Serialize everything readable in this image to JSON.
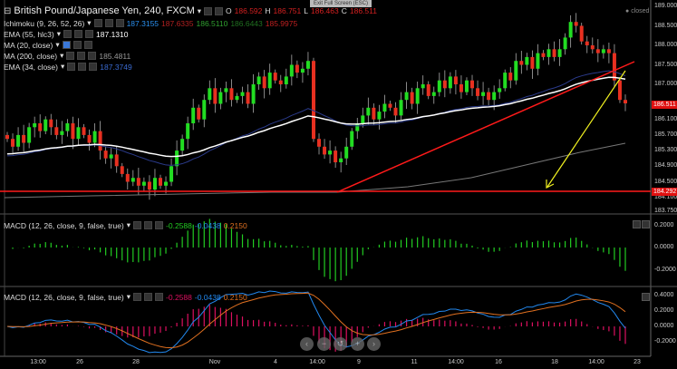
{
  "header": {
    "title": "British Pound/Japanese Yen, 240, FXCM",
    "o_label": "O",
    "o": "186.592",
    "h_label": "H",
    "h": "186.751",
    "l_label": "L",
    "l": "186.463",
    "c_label": "C",
    "c": "186.511"
  },
  "exit_fullscreen": "Exit Full Screen (ESC)",
  "status": "closed",
  "indicators": [
    {
      "label": "Ichimoku (9, 26, 52, 26)",
      "values": [
        "187.3155",
        "187.6335",
        "186.5110",
        "186.6443",
        "185.9975"
      ]
    },
    {
      "label": "EMA (55, hlc3)",
      "values": [
        "187.1310"
      ]
    },
    {
      "label": "MA (20, close)",
      "values": []
    },
    {
      "label": "MA (200, close)",
      "values": [
        "185.4811"
      ]
    },
    {
      "label": "EMA (34, close)",
      "values": [
        "187.3749"
      ]
    }
  ],
  "macd1": {
    "label": "MACD (12, 26, close, 9, false, true)",
    "values": [
      "-0.2588",
      "-0.0438",
      "0.2150"
    ]
  },
  "macd2": {
    "label": "MACD (12, 26, close, 9, false, true)",
    "values": [
      "-0.2588",
      "-0.0438",
      "0.2150"
    ]
  },
  "price_axis": [
    "189.000",
    "188.500",
    "188.000",
    "187.500",
    "187.000",
    "186.100",
    "185.700",
    "185.300",
    "184.900",
    "184.500",
    "184.100",
    "183.750"
  ],
  "price_axis_values": [
    189.0,
    188.5,
    188.0,
    187.5,
    187.0,
    186.1,
    185.7,
    185.3,
    184.9,
    184.5,
    184.1,
    183.75
  ],
  "last_price": "186.511",
  "hline_price": "184.292",
  "macd1_axis": [
    "0.2000",
    "0.0000",
    "-0.2000"
  ],
  "macd2_axis": [
    "0.4000",
    "0.2000",
    "0.0000",
    "-0.2000"
  ],
  "time_axis": [
    "13:00",
    "26",
    "28",
    "Nov",
    "4",
    "14:00",
    "9",
    "11",
    "14:00",
    "16",
    "18",
    "14:00",
    "23"
  ],
  "nav_buttons": [
    "‹",
    "−",
    "↺",
    "+",
    "›"
  ],
  "colors": {
    "up": "#22dd22",
    "down": "#e83020",
    "ema55": "#ffffff",
    "ema34": "#2a3a7a",
    "ma200": "#777777",
    "trend": "#ff1a1a",
    "arrow": "#f0f020",
    "macd": "#2288ee",
    "signal": "#e07020",
    "hist1": "#22cc22",
    "hist2": "#dd1060"
  },
  "chart_data": {
    "type": "candlestick",
    "closes": [
      185.6,
      185.4,
      185.7,
      185.5,
      185.9,
      186.0,
      185.8,
      186.1,
      185.9,
      185.7,
      185.8,
      186.0,
      185.6,
      185.9,
      185.7,
      185.5,
      185.8,
      185.3,
      185.1,
      185.2,
      184.9,
      184.7,
      184.5,
      184.6,
      184.4,
      184.5,
      184.3,
      184.6,
      184.4,
      184.5,
      184.9,
      185.3,
      185.6,
      186.0,
      186.4,
      186.1,
      186.6,
      186.9,
      186.5,
      186.8,
      186.9,
      186.6,
      186.7,
      186.8,
      186.5,
      187.0,
      187.2,
      186.9,
      187.3,
      187.1,
      187.0,
      187.2,
      187.5,
      187.3,
      187.4,
      187.6,
      185.6,
      185.4,
      185.2,
      185.3,
      185.0,
      185.1,
      185.4,
      185.8,
      186.0,
      186.2,
      186.4,
      186.1,
      186.3,
      186.5,
      186.4,
      186.2,
      186.6,
      186.8,
      186.5,
      186.9,
      187.0,
      186.7,
      186.8,
      187.1,
      186.9,
      187.2,
      187.0,
      186.8,
      187.1,
      186.9,
      186.7,
      186.8,
      186.6,
      186.8,
      186.9,
      187.3,
      187.1,
      187.6,
      187.5,
      187.7,
      187.4,
      187.8,
      187.7,
      187.9,
      187.7,
      187.9,
      188.2,
      188.6,
      188.5,
      188.1,
      188.0,
      187.9,
      187.8,
      187.9,
      187.8,
      187.1,
      186.6,
      186.511
    ],
    "ylim": [
      183.7,
      189.0
    ]
  }
}
